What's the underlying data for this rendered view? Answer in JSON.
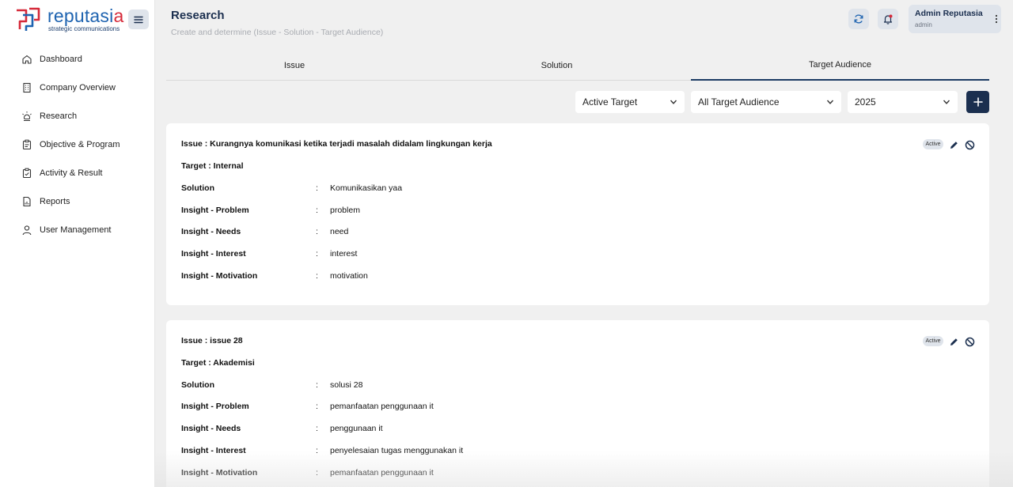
{
  "brand": {
    "name_main": "reputasi",
    "name_accent": "a",
    "tagline": "strategic communications"
  },
  "sidebar": {
    "items": [
      {
        "label": "Dashboard",
        "icon": "home-icon"
      },
      {
        "label": "Company Overview",
        "icon": "building-icon"
      },
      {
        "label": "Research",
        "icon": "bulb-icon"
      },
      {
        "label": "Objective & Program",
        "icon": "clipboard-icon"
      },
      {
        "label": "Activity & Result",
        "icon": "clipboard-check-icon"
      },
      {
        "label": "Reports",
        "icon": "report-icon"
      },
      {
        "label": "User Management",
        "icon": "user-icon"
      }
    ]
  },
  "header": {
    "title": "Research",
    "subtitle": "Create and determine (Issue - Solution - Target Audience)",
    "user_name": "Admin Reputasia",
    "user_role": "admin"
  },
  "tabs": [
    {
      "label": "Issue",
      "active": false
    },
    {
      "label": "Solution",
      "active": false
    },
    {
      "label": "Target Audience",
      "active": true
    }
  ],
  "filters": {
    "status": "Active Target",
    "audience": "All Target Audience",
    "year": "2025"
  },
  "labels": {
    "solution": "Solution",
    "problem": "Insight - Problem",
    "needs": "Insight - Needs",
    "interest": "Insight - Interest",
    "motivation": "Insight - Motivation",
    "colon": ":"
  },
  "cards": [
    {
      "issue": "Issue : Kurangnya komunikasi ketika terjadi masalah didalam lingkungan kerja",
      "target": "Target : Internal",
      "status": "Active",
      "solution": "Komunikasikan yaa",
      "problem": "problem",
      "needs": "need",
      "interest": "interest",
      "motivation": "motivation"
    },
    {
      "issue": "Issue : issue 28",
      "target": "Target : Akademisi",
      "status": "Active",
      "solution": "solusi 28",
      "problem": "pemanfaatan penggunaan it",
      "needs": "penggunaan it",
      "interest": "penyelesaian tugas menggunakan it",
      "motivation": "pemanfaatan penggunaan it"
    }
  ],
  "colors": {
    "primary": "#1b2f4f",
    "brand_blue": "#1e63b0",
    "brand_red": "#d62a3a"
  }
}
